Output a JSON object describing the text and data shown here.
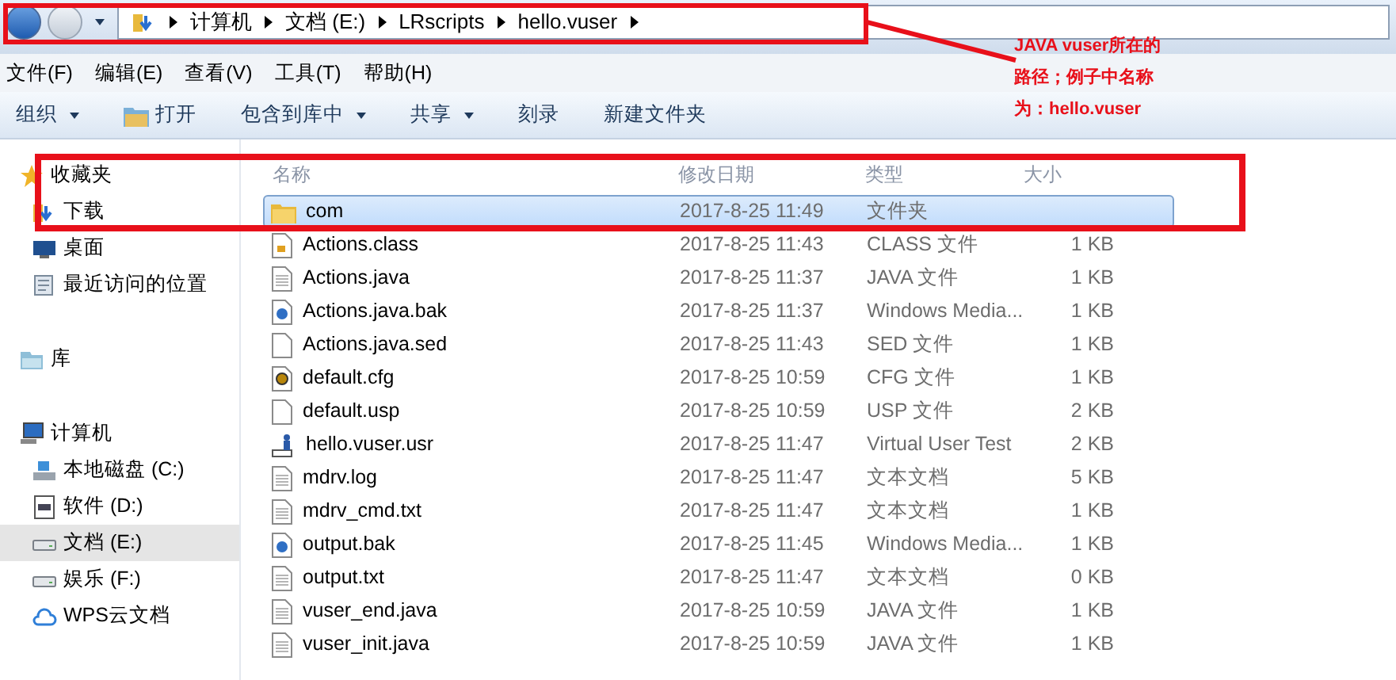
{
  "address_bar": {
    "segments": [
      "计算机",
      "文档 (E:)",
      "LRscripts",
      "hello.vuser"
    ]
  },
  "menu": [
    "文件(F)",
    "编辑(E)",
    "查看(V)",
    "工具(T)",
    "帮助(H)"
  ],
  "toolbar": [
    {
      "label": "组织",
      "kind": "dropdown"
    },
    {
      "label": "打开",
      "kind": "open"
    },
    {
      "label": "包含到库中",
      "kind": "dropdown"
    },
    {
      "label": "共享",
      "kind": "dropdown"
    },
    {
      "label": "刻录",
      "kind": "plain"
    },
    {
      "label": "新建文件夹",
      "kind": "plain"
    }
  ],
  "sidebar": [
    {
      "label": "收藏夹",
      "kind": "star",
      "selected": false,
      "children": [
        {
          "label": "下载",
          "kind": "download",
          "selected": false
        },
        {
          "label": "桌面",
          "kind": "desktop",
          "selected": false
        },
        {
          "label": "最近访问的位置",
          "kind": "recent",
          "selected": false
        }
      ]
    },
    {
      "label": "库",
      "kind": "library",
      "selected": false
    },
    {
      "label": "计算机",
      "kind": "computer",
      "selected": false,
      "children": [
        {
          "label": "本地磁盘 (C:)",
          "kind": "system-drive",
          "selected": false
        },
        {
          "label": "软件 (D:)",
          "kind": "disk",
          "selected": false
        },
        {
          "label": "文档 (E:)",
          "kind": "drive",
          "selected": true
        },
        {
          "label": "娱乐 (F:)",
          "kind": "drive",
          "selected": false
        },
        {
          "label": "WPS云文档",
          "kind": "cloud",
          "selected": false
        }
      ]
    }
  ],
  "table": {
    "columns": [
      "名称",
      "修改日期",
      "类型",
      "大小"
    ],
    "rows": [
      {
        "name": "com",
        "modified": "2017-8-25 11:49",
        "type": "文件夹",
        "size": "",
        "kind": "folder",
        "selected": true
      },
      {
        "name": "Actions.class",
        "modified": "2017-8-25 11:43",
        "type": "CLASS 文件",
        "size": "1 KB",
        "kind": "class",
        "selected": false
      },
      {
        "name": "Actions.java",
        "modified": "2017-8-25 11:37",
        "type": "JAVA 文件",
        "size": "1 KB",
        "kind": "text",
        "selected": false
      },
      {
        "name": "Actions.java.bak",
        "modified": "2017-8-25 11:37",
        "type": "Windows Media...",
        "size": "1 KB",
        "kind": "media",
        "selected": false
      },
      {
        "name": "Actions.java.sed",
        "modified": "2017-8-25 11:43",
        "type": "SED 文件",
        "size": "1 KB",
        "kind": "blank",
        "selected": false
      },
      {
        "name": "default.cfg",
        "modified": "2017-8-25 10:59",
        "type": "CFG 文件",
        "size": "1 KB",
        "kind": "config",
        "selected": false
      },
      {
        "name": "default.usp",
        "modified": "2017-8-25 10:59",
        "type": "USP 文件",
        "size": "2 KB",
        "kind": "blank",
        "selected": false
      },
      {
        "name": "hello.vuser.usr",
        "modified": "2017-8-25 11:47",
        "type": "Virtual User Test",
        "size": "2 KB",
        "kind": "user",
        "selected": false
      },
      {
        "name": "mdrv.log",
        "modified": "2017-8-25 11:47",
        "type": "文本文档",
        "size": "5 KB",
        "kind": "text",
        "selected": false
      },
      {
        "name": "mdrv_cmd.txt",
        "modified": "2017-8-25 11:47",
        "type": "文本文档",
        "size": "1 KB",
        "kind": "text",
        "selected": false
      },
      {
        "name": "output.bak",
        "modified": "2017-8-25 11:45",
        "type": "Windows Media...",
        "size": "1 KB",
        "kind": "media",
        "selected": false
      },
      {
        "name": "output.txt",
        "modified": "2017-8-25 11:47",
        "type": "文本文档",
        "size": "0 KB",
        "kind": "text",
        "selected": false
      },
      {
        "name": "vuser_end.java",
        "modified": "2017-8-25 10:59",
        "type": "JAVA 文件",
        "size": "1 KB",
        "kind": "text",
        "selected": false
      },
      {
        "name": "vuser_init.java",
        "modified": "2017-8-25 10:59",
        "type": "JAVA 文件",
        "size": "1 KB",
        "kind": "text",
        "selected": false
      }
    ]
  },
  "annotation": {
    "lines": [
      "JAVA vuser所在的",
      "路径；例子中名称",
      "为：hello.vuser"
    ]
  }
}
